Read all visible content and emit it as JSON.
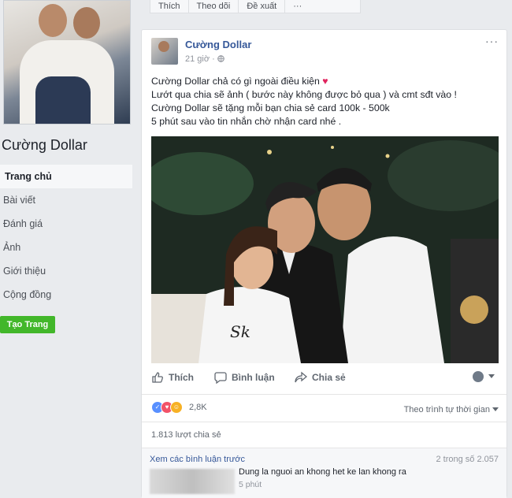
{
  "page": {
    "name": "Cường Dollar",
    "nav": [
      "Trang chủ",
      "Bài viết",
      "Đánh giá",
      "Ảnh",
      "Giới thiệu",
      "Cộng đồng"
    ],
    "create_button": "Tạo Trang"
  },
  "top_actions": {
    "like": "Thích",
    "follow": "Theo dõi",
    "suggest": "Đề xuất",
    "more": "···"
  },
  "post": {
    "author": "Cường Dollar",
    "time": "21 giờ · ",
    "menu": "···",
    "lines": [
      "Cường Dollar chả có gì ngoài điều kiện",
      "Lướt qua chia sẽ ảnh ( bước này không được bỏ qua ) và cmt sđt vào !",
      "Cường Dollar sẽ tặng mỗi bạn chia sẻ card 100k - 500k",
      "5 phút sau vào tin nhắn chờ nhận card nhé ."
    ],
    "heart": "♥",
    "actions": {
      "like": "Thích",
      "comment": "Bình luận",
      "share": "Chia sẻ"
    },
    "reaction_count": "2,8K",
    "order_label": "Theo trình tự thời gian",
    "shares": "1.813 lượt chia sẻ",
    "comments": {
      "view_previous": "Xem các bình luận trước",
      "count": "2 trong số 2.057",
      "items": [
        {
          "text": "Dung la nguoi an khong het ke lan khong ra",
          "time": "5 phút"
        }
      ]
    }
  },
  "colors": {
    "brand_blue": "#365899",
    "green": "#42b72a",
    "heart": "#e0245e"
  }
}
